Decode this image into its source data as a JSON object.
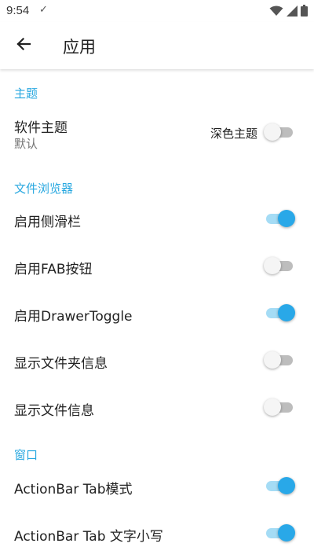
{
  "status_bar": {
    "time": "9:54",
    "check": "✓"
  },
  "app_bar": {
    "title": "应用"
  },
  "sections": [
    {
      "header": "主题"
    },
    {
      "header": "文件浏览器"
    },
    {
      "header": "窗口"
    }
  ],
  "theme": {
    "title": "软件主题",
    "subtitle": "默认",
    "switch_label": "深色主题",
    "dark_theme_on": false
  },
  "file_browser": {
    "items": [
      {
        "label": "启用侧滑栏",
        "on": true
      },
      {
        "label": "启用FAB按钮",
        "on": false
      },
      {
        "label": "启用DrawerToggle",
        "on": true
      },
      {
        "label": "显示文件夹信息",
        "on": false
      },
      {
        "label": "显示文件信息",
        "on": false
      }
    ]
  },
  "window": {
    "items": [
      {
        "label": "ActionBar Tab模式",
        "on": true
      },
      {
        "label": "ActionBar Tab 文字小写",
        "on": true
      }
    ]
  },
  "colors": {
    "accent": "#29a8e8",
    "section_header": "#29a8e0",
    "track_on": "#a5dcf5",
    "track_off": "#bdbdbd"
  }
}
